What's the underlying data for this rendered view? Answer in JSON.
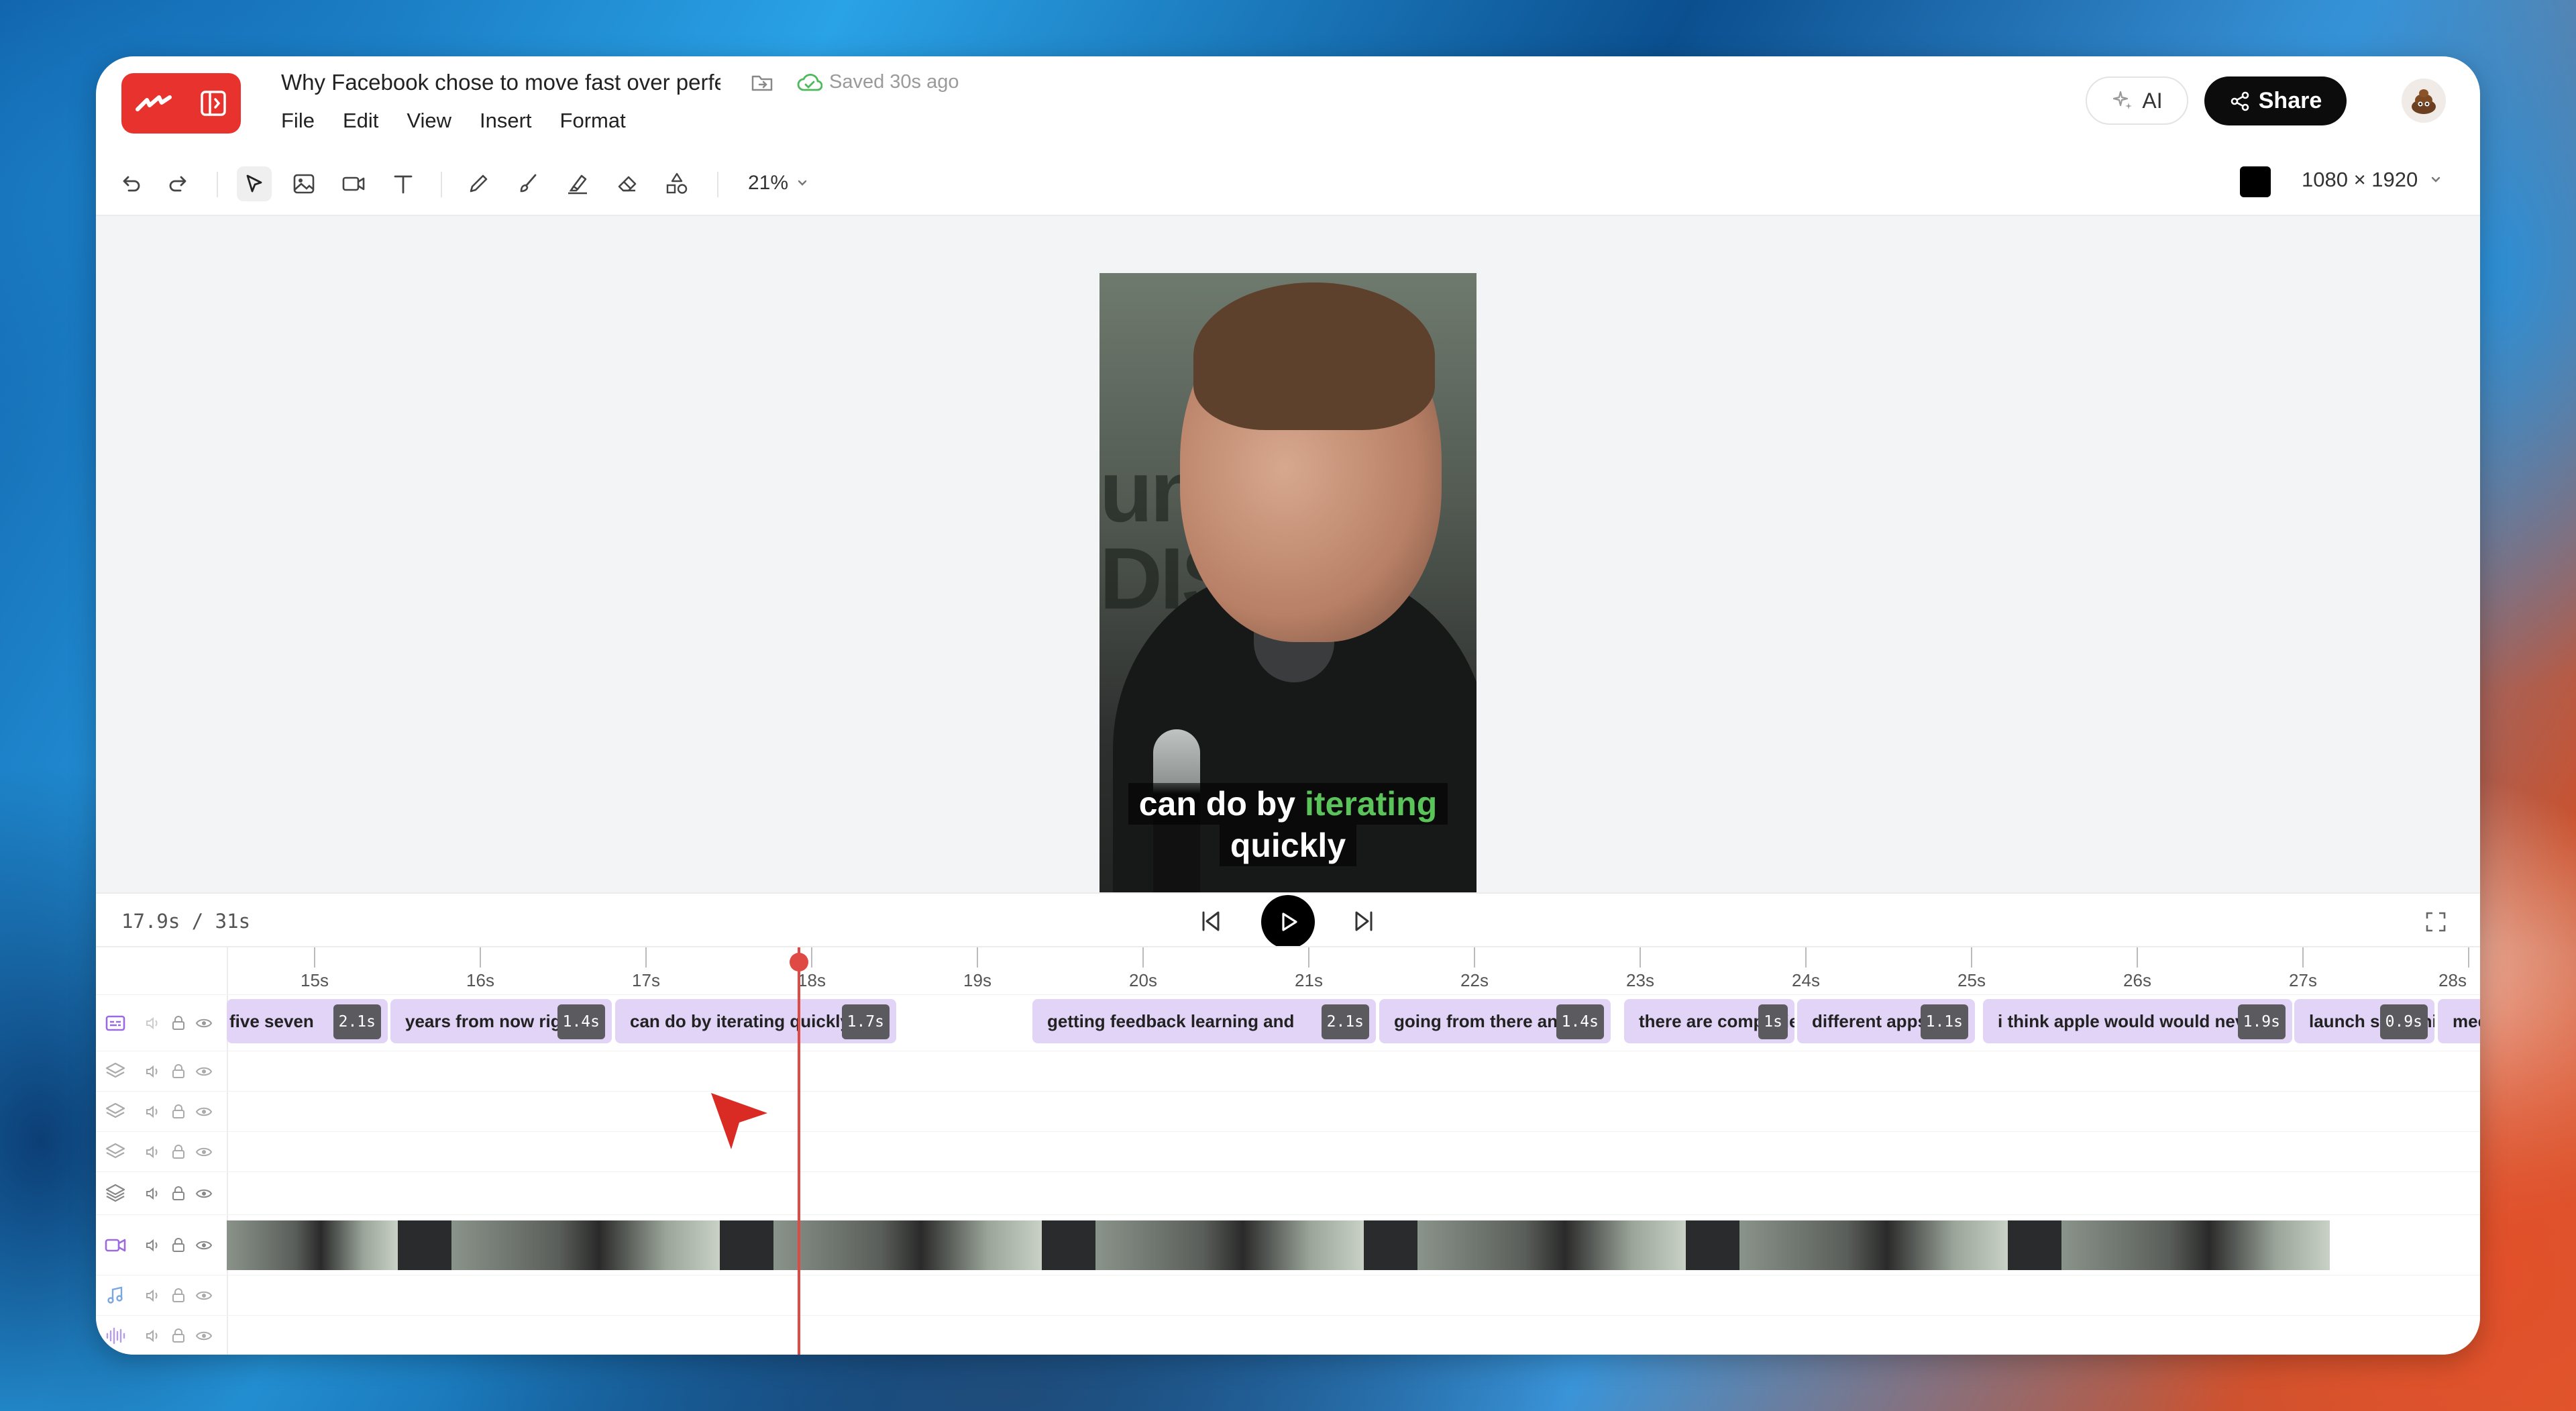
{
  "app": {
    "doc_title": "Why Facebook chose to move fast over perfect",
    "save_status": "Saved 30s ago",
    "menu": [
      "File",
      "Edit",
      "View",
      "Insert",
      "Format"
    ],
    "ai_label": "AI",
    "share_label": "Share"
  },
  "toolbar": {
    "zoom": "21%",
    "dimensions": "1080 × 1920",
    "fill_color": "#000000",
    "tools": [
      "undo-icon",
      "redo-icon",
      "select-icon",
      "image-icon",
      "video-icon",
      "text-icon",
      "pencil-icon",
      "brush-icon",
      "highlighter-icon",
      "eraser-icon",
      "shapes-icon"
    ]
  },
  "preview": {
    "bg_text": "unch DISR",
    "caption_line1_a": "can do by",
    "caption_line1_b": "iterating",
    "caption_line2": "quickly",
    "highlight_color": "#5ac35a"
  },
  "playback": {
    "time": "17.9s / 31s"
  },
  "timeline": {
    "ticks": [
      "15s",
      "16s",
      "17s",
      "18s",
      "19s",
      "20s",
      "21s",
      "22s",
      "23s",
      "24s",
      "25s",
      "26s",
      "27s",
      "28s"
    ],
    "captions": [
      {
        "text": "five seven",
        "duration": "2.1s"
      },
      {
        "text": "years from now right",
        "duration": "1.4s"
      },
      {
        "text": "can do by iterating quickly",
        "duration": "1.7s"
      },
      {
        "text": "getting feedback learning and",
        "duration": "2.1s"
      },
      {
        "text": "going from there and",
        "duration": "1.4s"
      },
      {
        "text": "there are companies",
        "duration": "1s"
      },
      {
        "text": "different apps",
        "duration": "1.1s"
      },
      {
        "text": "i think apple would would never",
        "duration": "1.9s"
      },
      {
        "text": "launch something",
        "duration": "0.9s"
      },
      {
        "text": "mee",
        "duration": ""
      }
    ]
  }
}
